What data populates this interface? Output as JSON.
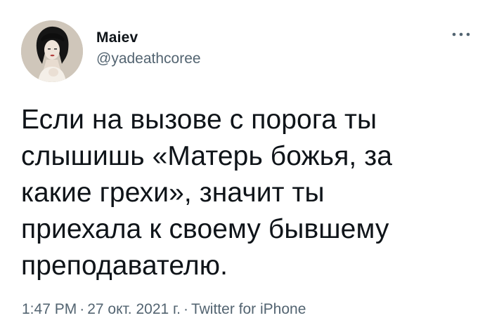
{
  "user": {
    "display_name": "Maiev",
    "handle": "@yadeathcoree",
    "avatar_icon": "profile-photo"
  },
  "tweet": {
    "lines": [
      "Если на вызове с порога ты",
      "слышишь «Матерь божья, за",
      "какие грехи», значит ты",
      "приехала к своему бывшему",
      "преподавателю."
    ]
  },
  "meta": {
    "time": "1:47 PM",
    "date": "27 окт. 2021 г.",
    "separator": "·",
    "source": "Twitter for iPhone"
  },
  "colors": {
    "text": "#0f1419",
    "secondary": "#536471",
    "background": "#ffffff"
  },
  "icons": {
    "more": "more-dots-icon"
  }
}
